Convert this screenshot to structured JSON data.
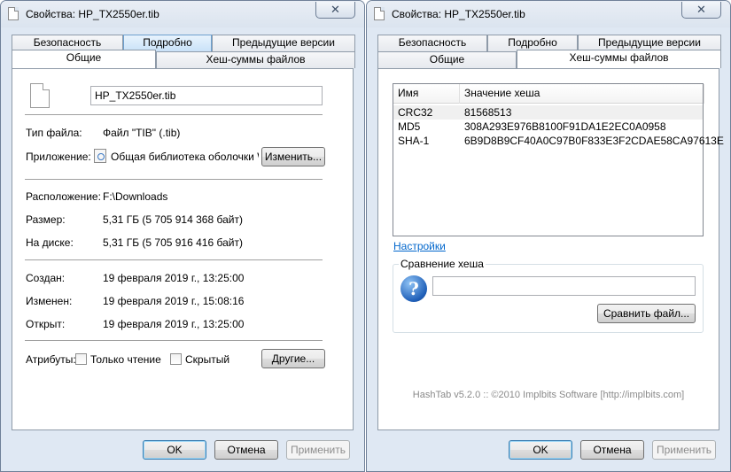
{
  "left_window": {
    "title": "Свойства: HP_TX2550er.tib",
    "close_glyph": "✕",
    "tabs_row1": [
      "Безопасность",
      "Подробно",
      "Предыдущие версии"
    ],
    "tabs_row2": [
      "Общие",
      "Хеш-суммы файлов"
    ],
    "filename": "HP_TX2550er.tib",
    "file_type_label": "Тип файла:",
    "file_type_value": "Файл \"TIB\" (.tib)",
    "app_label": "Приложение:",
    "app_value": "Общая библиотека оболочки Wi",
    "change_button": "Изменить...",
    "location_label": "Расположение:",
    "location_value": "F:\\Downloads",
    "size_label": "Размер:",
    "size_value": "5,31 ГБ (5 705 914 368 байт)",
    "disk_label": "На диске:",
    "disk_value": "5,31 ГБ (5 705 916 416 байт)",
    "created_label": "Создан:",
    "created_value": "19 февраля 2019 г., 13:25:00",
    "modified_label": "Изменен:",
    "modified_value": "19 февраля 2019 г., 15:08:16",
    "opened_label": "Открыт:",
    "opened_value": "19 февраля 2019 г., 13:25:00",
    "attributes_label": "Атрибуты:",
    "readonly_label": "Только чтение",
    "hidden_label": "Скрытый",
    "other_button": "Другие...",
    "ok": "OK",
    "cancel": "Отмена",
    "apply": "Применить"
  },
  "right_window": {
    "title": "Свойства: HP_TX2550er.tib",
    "close_glyph": "✕",
    "tabs_row1": [
      "Безопасность",
      "Подробно",
      "Предыдущие версии"
    ],
    "tabs_row2": [
      "Общие",
      "Хеш-суммы файлов"
    ],
    "columns": [
      "Имя",
      "Значение хеша"
    ],
    "hashes": [
      {
        "name": "CRC32",
        "value": "81568513"
      },
      {
        "name": "MD5",
        "value": "308A293E976B8100F91DA1E2EC0A0958"
      },
      {
        "name": "SHA-1",
        "value": "6B9D8B9CF40A0C97B0F833E3F2CDAE58CA97613E"
      }
    ],
    "settings_link": "Настройки",
    "compare_group": "Сравнение хеша",
    "compare_input_value": "",
    "compare_button": "Сравнить файл...",
    "question_glyph": "?",
    "footer": "HashTab v5.2.0 :: ©2010 Implbits Software [http://implbits.com]",
    "ok": "OK",
    "cancel": "Отмена",
    "apply": "Применить"
  }
}
